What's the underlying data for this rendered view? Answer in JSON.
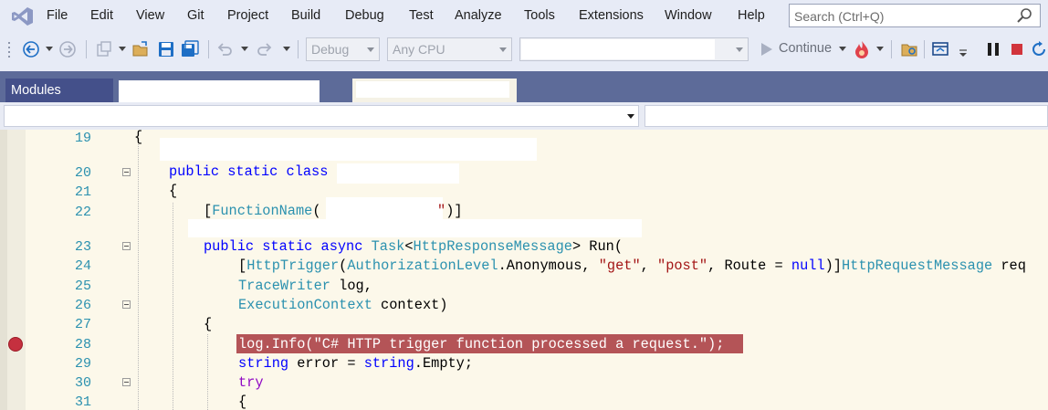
{
  "menu": {
    "items": [
      "File",
      "Edit",
      "View",
      "Git",
      "Project",
      "Build",
      "Debug",
      "Test",
      "Analyze",
      "Tools",
      "Extensions",
      "Window",
      "Help"
    ],
    "search_placeholder": "Search (Ctrl+Q)"
  },
  "toolbar": {
    "config_combo": "Debug",
    "platform_combo": "Any CPU",
    "continue_label": "Continue"
  },
  "tabs": {
    "modules_label": "Modules"
  },
  "editor": {
    "lines": [
      {
        "num": "19"
      },
      {
        "num": "20"
      },
      {
        "num": "21"
      },
      {
        "num": "22"
      },
      {
        "num": "23"
      },
      {
        "num": "24"
      },
      {
        "num": "25"
      },
      {
        "num": "26"
      },
      {
        "num": "27"
      },
      {
        "num": "28"
      },
      {
        "num": "29"
      },
      {
        "num": "30"
      },
      {
        "num": "31"
      }
    ],
    "code": {
      "l19": "{",
      "l20_kw": "public static class",
      "l21": "{",
      "l22_open": "[",
      "l22_attr": "FunctionName",
      "l22_paren": "(",
      "l22_close": "\")]",
      "l23_kw": "public static async",
      "l23_task": "Task",
      "l23_lt": "<",
      "l23_type": "HttpResponseMessage",
      "l23_rest": "> Run(",
      "l24_open": "[",
      "l24_attr": "HttpTrigger",
      "l24_p1": "(",
      "l24_level": "AuthorizationLevel",
      "l24_dot": ".Anonymous, ",
      "l24_get": "\"get\"",
      "l24_comma": ", ",
      "l24_post": "\"post\"",
      "l24_route": ", Route = ",
      "l24_null": "null",
      "l24_close": ")]",
      "l24_type": "HttpRequestMessage",
      "l24_req": " req",
      "l25_type": "TraceWriter",
      "l25_rest": " log,",
      "l26_type": "ExecutionContext",
      "l26_rest": " context)",
      "l27": "{",
      "l28": "log.Info(\"C# HTTP trigger function processed a request.\");",
      "l29_kw": "string",
      "l29_mid": " error = ",
      "l29_kw2": "string",
      "l29_rest": ".Empty;",
      "l30": "try",
      "l31": "{"
    }
  },
  "colors": {
    "accent": "#5d6b99",
    "breakpoint": "#c5303f",
    "breakpoint_highlight": "#b45457",
    "keyword": "#0000ff",
    "type": "#2b91af",
    "string": "#a31515"
  }
}
